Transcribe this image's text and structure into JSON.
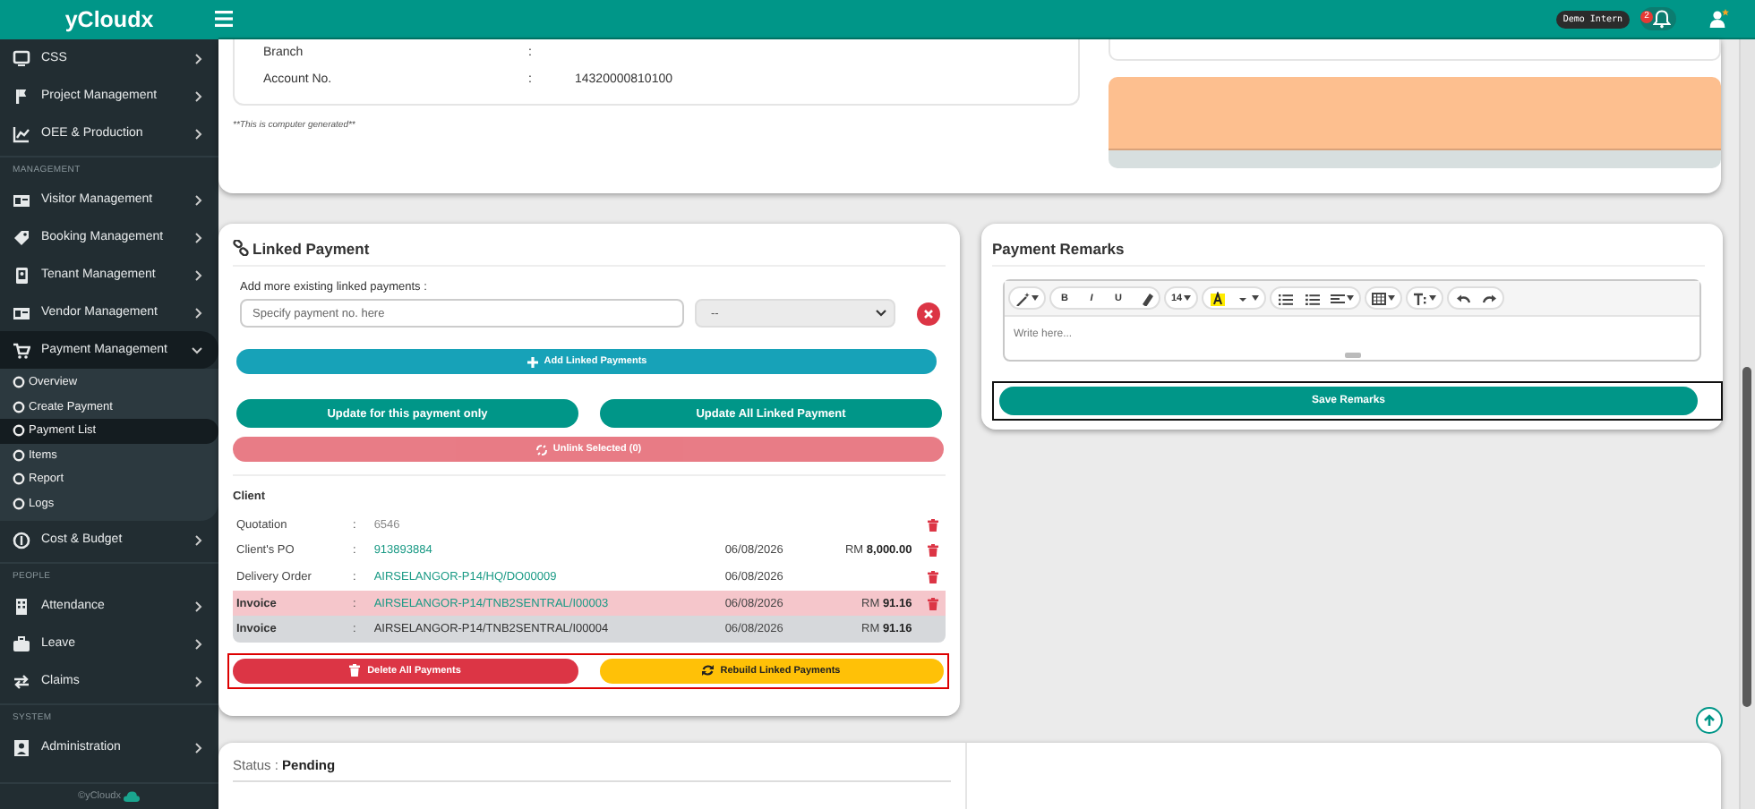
{
  "topbar": {
    "user_badge": "Demo Intern",
    "notification_count": "2"
  },
  "sidebar": {
    "logo": "yCloudx",
    "sections": [
      {
        "items": [
          {
            "label": "CSS",
            "selected": false,
            "expanded": false
          },
          {
            "label": "Project Management",
            "selected": false,
            "expanded": false
          },
          {
            "label": "OEE & Production",
            "selected": false,
            "expanded": false
          }
        ]
      },
      {
        "heading": "MANAGEMENT",
        "items": [
          {
            "label": "Visitor Management",
            "selected": false,
            "expanded": false
          },
          {
            "label": "Booking Management",
            "selected": false,
            "expanded": false
          },
          {
            "label": "Tenant Management",
            "selected": false,
            "expanded": false
          },
          {
            "label": "Vendor Management",
            "selected": false,
            "expanded": false
          },
          {
            "label": "Payment Management",
            "selected": true,
            "expanded": true,
            "children": [
              {
                "label": "Overview",
                "selected": false
              },
              {
                "label": "Create Payment",
                "selected": false
              },
              {
                "label": "Payment List",
                "selected": true
              },
              {
                "label": "Items",
                "selected": false
              },
              {
                "label": "Report",
                "selected": false
              },
              {
                "label": "Logs",
                "selected": false
              }
            ]
          },
          {
            "label": "Cost & Budget",
            "selected": false,
            "expanded": false
          }
        ]
      },
      {
        "heading": "PEOPLE",
        "items": [
          {
            "label": "Attendance",
            "selected": false,
            "expanded": false
          },
          {
            "label": "Leave",
            "selected": false,
            "expanded": false
          },
          {
            "label": "Claims",
            "selected": false,
            "expanded": false
          }
        ]
      },
      {
        "heading": "SYSTEM",
        "items": [
          {
            "label": "Administration",
            "selected": false,
            "expanded": false
          }
        ]
      }
    ],
    "footer": "©yCloudx"
  },
  "bank_details": {
    "rows": [
      {
        "label": "Branch",
        "separator": ":"
      },
      {
        "label": "Account No.",
        "separator": ":",
        "value": "14320000810100"
      }
    ],
    "note": "**This is computer generated**"
  },
  "linked_payment": {
    "title": "Linked Payment",
    "add_label": "Add more existing linked payments :",
    "input": {
      "placeholder": "Specify payment no. here"
    },
    "select": {
      "value": "--"
    },
    "buttons": [
      {
        "kind": "add",
        "label": "Add Linked Payments",
        "disabled": false
      },
      {
        "kind": "update",
        "label": "Update for this payment only",
        "disabled": false
      },
      {
        "kind": "update",
        "label": "Update All Linked Payment",
        "disabled": false
      },
      {
        "kind": "unlink",
        "label": "Unlink Selected (0)",
        "disabled": true
      }
    ],
    "group_title": "Client",
    "rows": [
      {
        "label": "Quotation",
        "separator": ":",
        "value": "6546",
        "kind": "muted",
        "deletable": true,
        "selected": false,
        "current": false
      },
      {
        "label": "Client's PO",
        "separator": ":",
        "value": "913893884",
        "kind": "link",
        "date": "06/08/2026",
        "amount": "RM **8,000.00**",
        "deletable": true,
        "selected": false,
        "current": false
      },
      {
        "label": "Delivery Order",
        "separator": ":",
        "value": "AIRSELANGOR-P14/HQ/DO00009",
        "kind": "link",
        "date": "06/08/2026",
        "deletable": true,
        "selected": false,
        "current": false
      },
      {
        "label": "Invoice",
        "separator": ":",
        "value": "AIRSELANGOR-P14/TNB2SENTRAL/I00003",
        "kind": "link",
        "date": "06/08/2026",
        "amount": "RM **91.16**",
        "deletable": true,
        "selected": true,
        "current": false
      },
      {
        "label": "Invoice",
        "separator": ":",
        "value": "AIRSELANGOR-P14/TNB2SENTRAL/I00004",
        "kind": "plain",
        "date": "06/08/2026",
        "amount": "RM **91.16**",
        "deletable": false,
        "selected": false,
        "current": true
      }
    ],
    "actions": [
      {
        "kind": "delete",
        "label": "Delete All Payments"
      },
      {
        "kind": "rebuild",
        "label": "Rebuild Linked Payments"
      }
    ]
  },
  "payment_remarks": {
    "title": "Payment Remarks",
    "toolbar": [
      [
        {
          "kind": "icon",
          "dropdown": true
        }
      ],
      [
        {
          "kind": "text",
          "label": "B",
          "dropdown": false
        },
        {
          "kind": "text",
          "label": "I",
          "dropdown": false
        },
        {
          "kind": "text",
          "label": "U",
          "dropdown": false
        },
        {
          "kind": "icon",
          "dropdown": false
        }
      ],
      [
        {
          "kind": "text",
          "label": "14",
          "dropdown": true
        }
      ],
      [
        {
          "kind": "icon",
          "dropdown": false
        },
        {
          "kind": "icon",
          "dropdown": true
        }
      ],
      [
        {
          "kind": "icon",
          "dropdown": false
        },
        {
          "kind": "icon",
          "dropdown": false
        },
        {
          "kind": "icon",
          "dropdown": true
        }
      ],
      [
        {
          "kind": "icon",
          "dropdown": true
        }
      ],
      [
        {
          "kind": "icon",
          "dropdown": true
        }
      ],
      [
        {
          "kind": "icon",
          "dropdown": false
        },
        {
          "kind": "icon",
          "dropdown": false
        }
      ]
    ],
    "editor": {
      "placeholder": "Write here..."
    },
    "save_button": "Save Remarks"
  },
  "status": {
    "text": "Status : **Pending**"
  }
}
